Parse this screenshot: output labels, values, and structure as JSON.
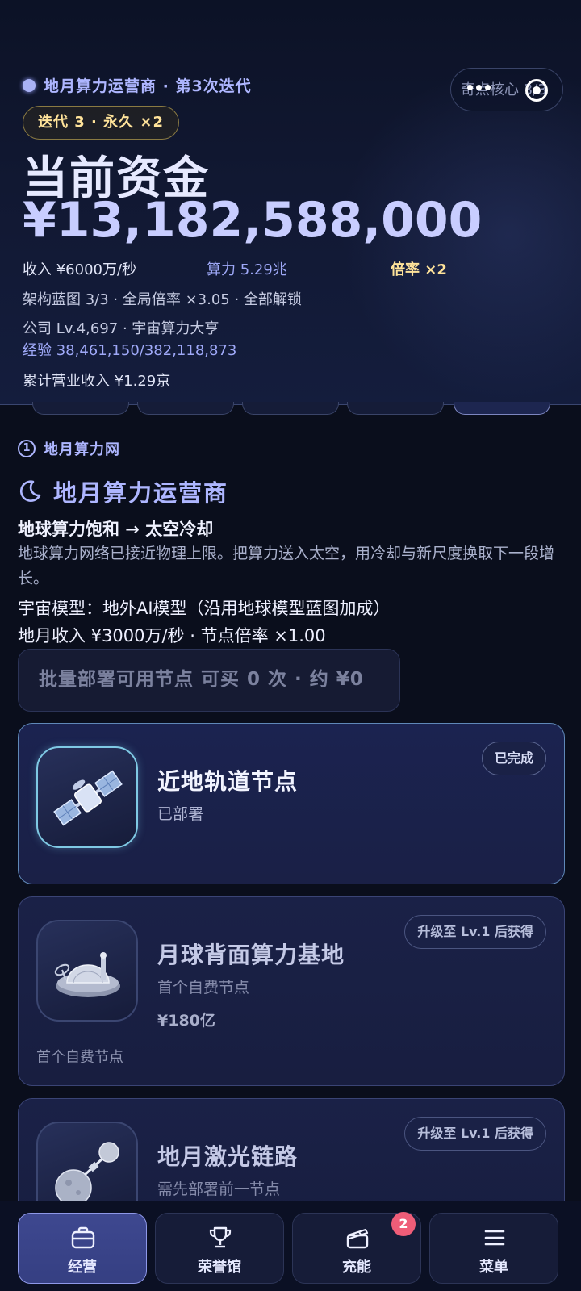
{
  "header": {
    "breadcrumb": "地月算力运营商 · 第3次迭代",
    "capsule_hint": "奇点核心 3/3",
    "iteration_badge": "迭代 3 · 永久 ×2",
    "funds_title": "当前资金",
    "funds_value": "¥13,182,588,000",
    "income": "收入 ¥6000万/秒",
    "compute": "算力 5.29兆",
    "multiplier": "倍率 ×2",
    "blueprint": "架构蓝图 3/3 · 全局倍率 ×3.05 · 全部解锁",
    "company": "公司 Lv.4,697 · 宇宙算力大亨",
    "experience": "经验 38,461,150/382,118,873",
    "total_revenue": "累计营业收入 ¥1.29京"
  },
  "section": {
    "number": "1",
    "title": "地月算力网"
  },
  "operator": {
    "icon": "moon-icon",
    "title": "地月算力运营商",
    "story_head": "地球算力饱和 → 太空冷却",
    "story_body": "地球算力网络已接近物理上限。把算力送入太空，用冷却与新尺度换取下一段增长。",
    "model": "宇宙模型：地外AI模型（沿用地球模型蓝图加成）",
    "income": "地月收入 ¥3000万/秒 · 节点倍率 ×1.00"
  },
  "batch_button": "批量部署可用节点 可买 0 次 · 约 ¥0",
  "nodes": [
    {
      "name": "近地轨道节点",
      "sub": "已部署",
      "status": "已完成",
      "icon": "satellite-icon"
    },
    {
      "name": "月球背面算力基地",
      "sub": "首个自费节点",
      "price": "¥180亿",
      "foot": "首个自费节点",
      "status": "升级至 Lv.1 后获得",
      "icon": "moon-base-icon"
    },
    {
      "name": "地月激光链路",
      "sub": "需先部署前一节点",
      "status": "升级至 Lv.1 后获得",
      "icon": "laser-link-icon"
    }
  ],
  "bottom_nav": [
    {
      "label": "经营",
      "icon": "briefcase-icon",
      "active": true
    },
    {
      "label": "荣誉馆",
      "icon": "trophy-icon"
    },
    {
      "label": "充能",
      "icon": "clapperboard-icon",
      "badge": "2"
    },
    {
      "label": "菜单",
      "icon": "menu-icon"
    }
  ],
  "colors": {
    "accent": "#aeb6ff",
    "gold": "#ffe39a",
    "badge_red": "#ef5d78",
    "background": "#0a0e1c"
  }
}
